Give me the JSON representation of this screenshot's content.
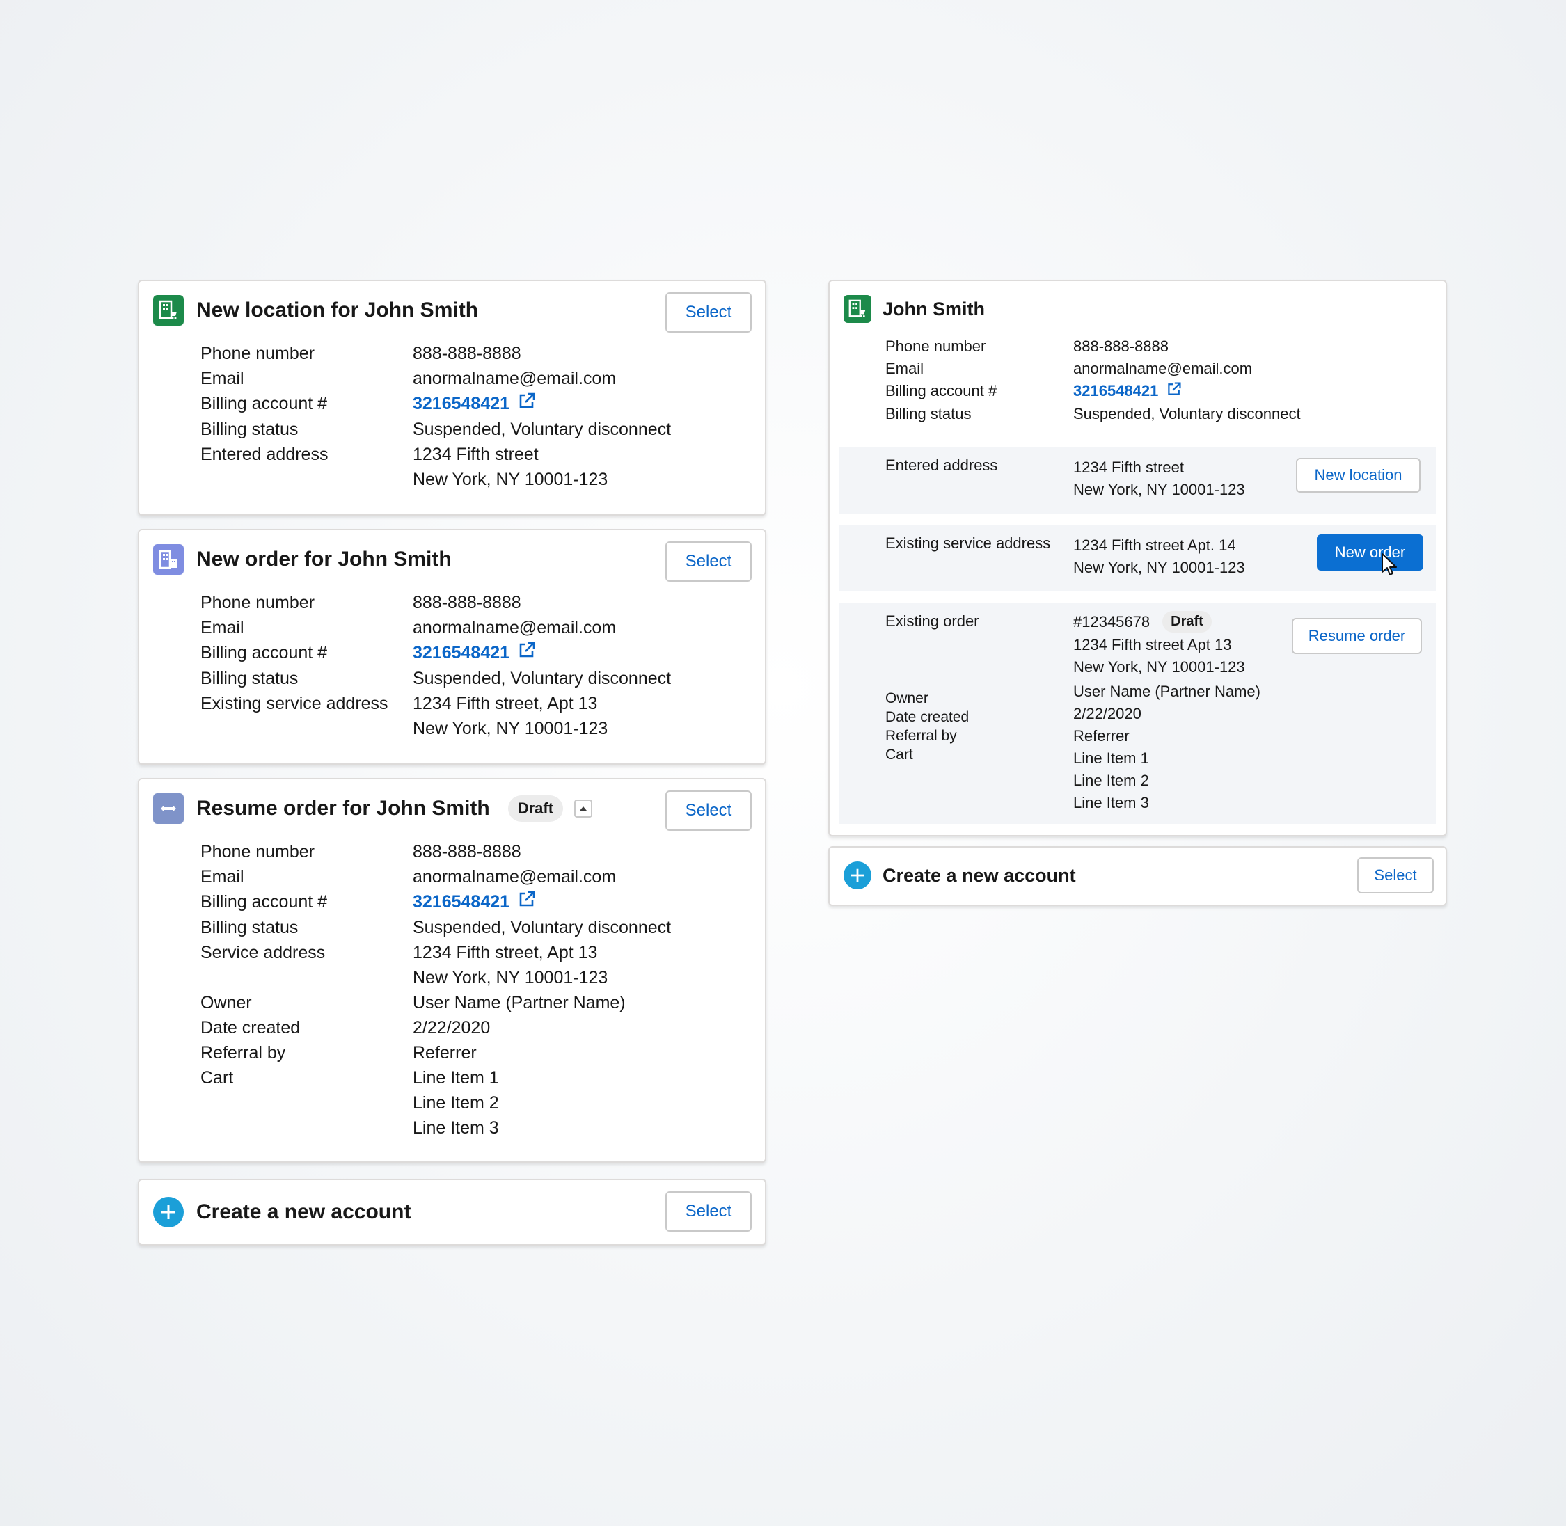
{
  "select_label": "Select",
  "cards": {
    "new_location": {
      "title": "New location for John Smith",
      "fields": [
        {
          "label": "Phone number",
          "value": "888-888-8888"
        },
        {
          "label": "Email",
          "value": "anormalname@email.com"
        },
        {
          "label": "Billing account #",
          "value": "3216548421"
        },
        {
          "label": "Billing status",
          "value": "Suspended, Voluntary disconnect"
        },
        {
          "label": "Entered address",
          "value": "1234 Fifth street"
        },
        {
          "label": "",
          "value": "New York, NY 10001-123"
        }
      ]
    },
    "new_order": {
      "title": "New order for John Smith",
      "fields": [
        {
          "label": "Phone number",
          "value": "888-888-8888"
        },
        {
          "label": "Email",
          "value": "anormalname@email.com"
        },
        {
          "label": "Billing account #",
          "value": "3216548421"
        },
        {
          "label": "Billing status",
          "value": "Suspended, Voluntary disconnect"
        },
        {
          "label": "Existing service address",
          "value": "1234 Fifth street, Apt 13"
        },
        {
          "label": "",
          "value": "New York, NY 10001-123"
        }
      ]
    },
    "resume_order": {
      "title": "Resume order for John Smith",
      "badge": "Draft",
      "fields": [
        {
          "label": "Phone number",
          "value": "888-888-8888"
        },
        {
          "label": "Email",
          "value": "anormalname@email.com"
        },
        {
          "label": "Billing account #",
          "value": "3216548421"
        },
        {
          "label": "Billing status",
          "value": "Suspended, Voluntary disconnect"
        },
        {
          "label": "Service address",
          "value": "1234 Fifth street, Apt 13"
        },
        {
          "label": "",
          "value": "New York, NY 10001-123"
        },
        {
          "label": "Owner",
          "value": "User Name (Partner Name)"
        },
        {
          "label": "Date created",
          "value": "2/22/2020"
        },
        {
          "label": "Referral by",
          "value": "Referrer"
        },
        {
          "label": "Cart",
          "value": "Line Item 1"
        },
        {
          "label": "",
          "value": "Line Item 2"
        },
        {
          "label": "",
          "value": "Line Item 3"
        }
      ]
    },
    "create_account_left": {
      "title": "Create a new account"
    },
    "john_smith": {
      "title": "John Smith",
      "fields": [
        {
          "label": "Phone number",
          "value": "888-888-8888"
        },
        {
          "label": "Email",
          "value": "anormalname@email.com"
        },
        {
          "label": "Billing account #",
          "value": "3216548421"
        },
        {
          "label": "Billing status",
          "value": "Suspended, Voluntary disconnect"
        }
      ],
      "entered_address": {
        "label": "Entered address",
        "line1": "1234 Fifth street",
        "line2": "New York, NY 10001-123",
        "button": "New location"
      },
      "existing_service": {
        "label": "Existing service address",
        "line1": "1234 Fifth street Apt. 14",
        "line2": "New York, NY 10001-123",
        "button": "New order"
      },
      "existing_order": {
        "label": "Existing order",
        "order_number": "#12345678",
        "badge": "Draft",
        "line1": "1234 Fifth street Apt 13",
        "line2": "New York, NY 10001-123",
        "button": "Resume order",
        "meta": [
          {
            "label": "Owner",
            "value": "User Name (Partner Name)"
          },
          {
            "label": "Date created",
            "value": "2/22/2020"
          },
          {
            "label": "Referral by",
            "value": "Referrer"
          },
          {
            "label": "Cart",
            "value": "Line Item 1"
          },
          {
            "label": "",
            "value": "Line Item 2"
          },
          {
            "label": "",
            "value": "Line Item 3"
          }
        ]
      }
    },
    "create_account_right": {
      "title": "Create a new account"
    }
  }
}
